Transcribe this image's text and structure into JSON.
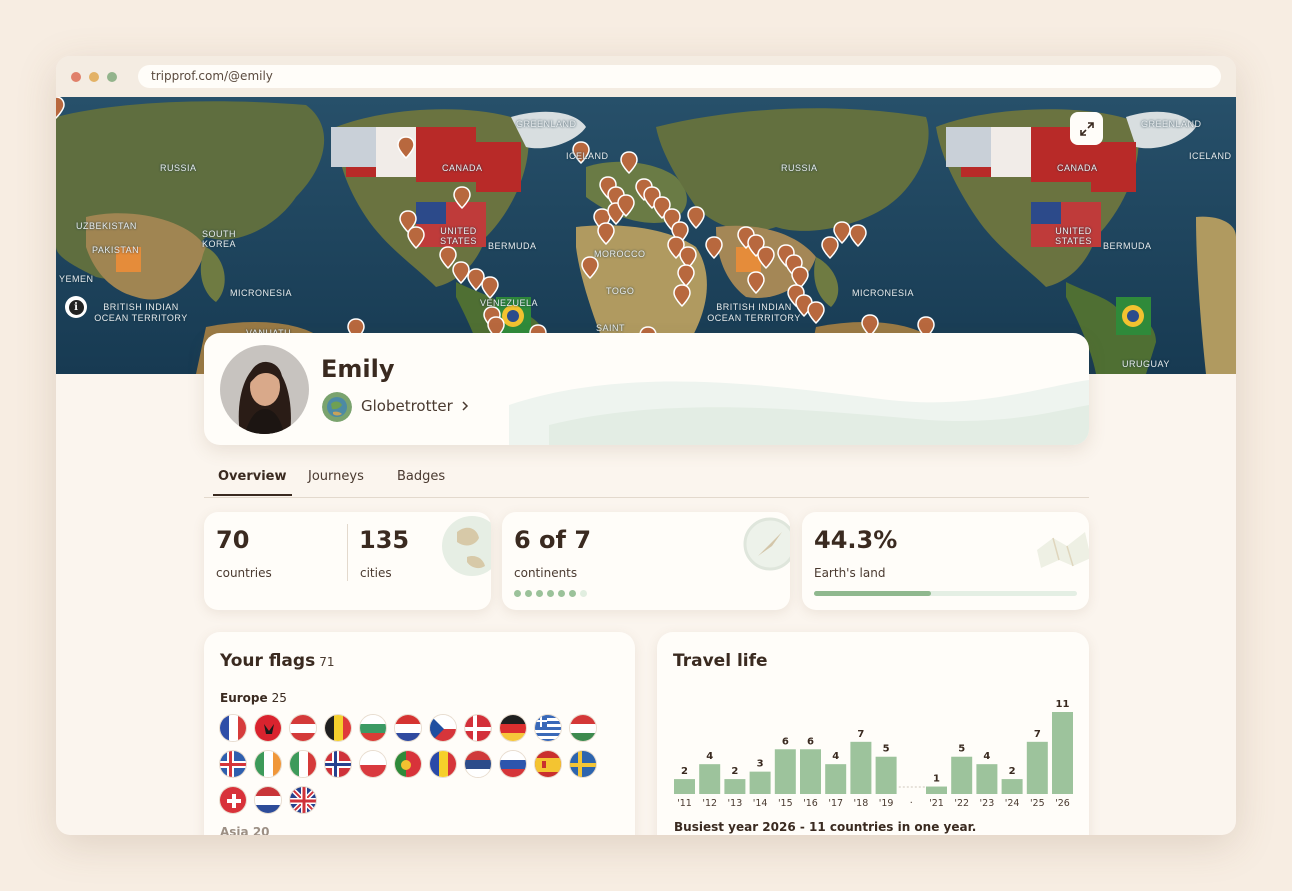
{
  "browser": {
    "url": "tripprof.com/@emily"
  },
  "map": {
    "labels": [
      {
        "text": "GREENLAND"
      },
      {
        "text": "RUSSIA"
      },
      {
        "text": "CANADA"
      },
      {
        "text": "ICELAND"
      },
      {
        "text": "UNITED STATES"
      },
      {
        "text": "BERMUDA"
      },
      {
        "text": "UZBEKISTAN"
      },
      {
        "text": "PAKISTAN"
      },
      {
        "text": "SOUTH KOREA"
      },
      {
        "text": "MICRONESIA"
      },
      {
        "text": "YEMEN"
      },
      {
        "text": "BRITISH INDIAN OCEAN TERRITORY"
      },
      {
        "text": "MOROCCO"
      },
      {
        "text": "TOGO"
      },
      {
        "text": "SAINT HELENA"
      },
      {
        "text": "VANUATU"
      },
      {
        "text": "VENEZUELA"
      },
      {
        "text": "URUGUAY"
      },
      {
        "text": "GREENLAND"
      },
      {
        "text": "RUSSIA"
      },
      {
        "text": "CANADA"
      },
      {
        "text": "ICELAND"
      },
      {
        "text": "UNITED STATES"
      },
      {
        "text": "BERMUDA"
      },
      {
        "text": "MICRONESIA"
      },
      {
        "text": "BRITISH INDIAN OCEAN TERRITORY"
      }
    ]
  },
  "profile": {
    "name": "Emily",
    "badge_label": "Globetrotter"
  },
  "tabs": [
    {
      "label": "Overview",
      "active": true
    },
    {
      "label": "Journeys",
      "active": false
    },
    {
      "label": "Badges",
      "active": false
    }
  ],
  "stats": {
    "countries": {
      "value": "70",
      "label": "countries"
    },
    "cities": {
      "value": "135",
      "label": "cities"
    },
    "continents": {
      "value": "6 of 7",
      "label": "continents",
      "visited": 6,
      "total": 7
    },
    "land": {
      "value": "44.3%",
      "label": "Earth's land",
      "fraction": 0.443
    }
  },
  "flags_panel": {
    "title": "Your flags",
    "count": "71",
    "regions": [
      {
        "name": "Europe",
        "count": "25",
        "flags": [
          "france",
          "albania",
          "austria",
          "belgium",
          "bulgaria",
          "croatia",
          "czechia",
          "denmark",
          "germany",
          "greece",
          "hungary",
          "iceland",
          "ireland",
          "italy",
          "norway",
          "poland",
          "portugal",
          "romania",
          "serbia",
          "slovenia",
          "spain",
          "sweden",
          "switzerland",
          "netherlands",
          "united-kingdom"
        ]
      }
    ],
    "next_region_partial": "Asia  20"
  },
  "travel_panel": {
    "title": "Travel life",
    "busiest": "Busiest year 2026 - 11 countries in one year."
  },
  "chart_data": {
    "type": "bar",
    "categories": [
      "'11",
      "'12",
      "'13",
      "'14",
      "'15",
      "'16",
      "'17",
      "'18",
      "'19",
      "·",
      "'21",
      "'22",
      "'23",
      "'24",
      "'25",
      "'26"
    ],
    "values": [
      2,
      4,
      2,
      3,
      6,
      6,
      4,
      7,
      5,
      null,
      1,
      5,
      4,
      2,
      7,
      11
    ],
    "gap_index": 9,
    "color": "#9dc39c",
    "ylim": [
      0,
      11
    ],
    "title": "",
    "xlabel": "",
    "ylabel": ""
  },
  "colors": {
    "background": "#f7ede2",
    "card": "#fffdf9",
    "accent_green": "#9dc39c",
    "text_dark": "#3a2a20"
  }
}
